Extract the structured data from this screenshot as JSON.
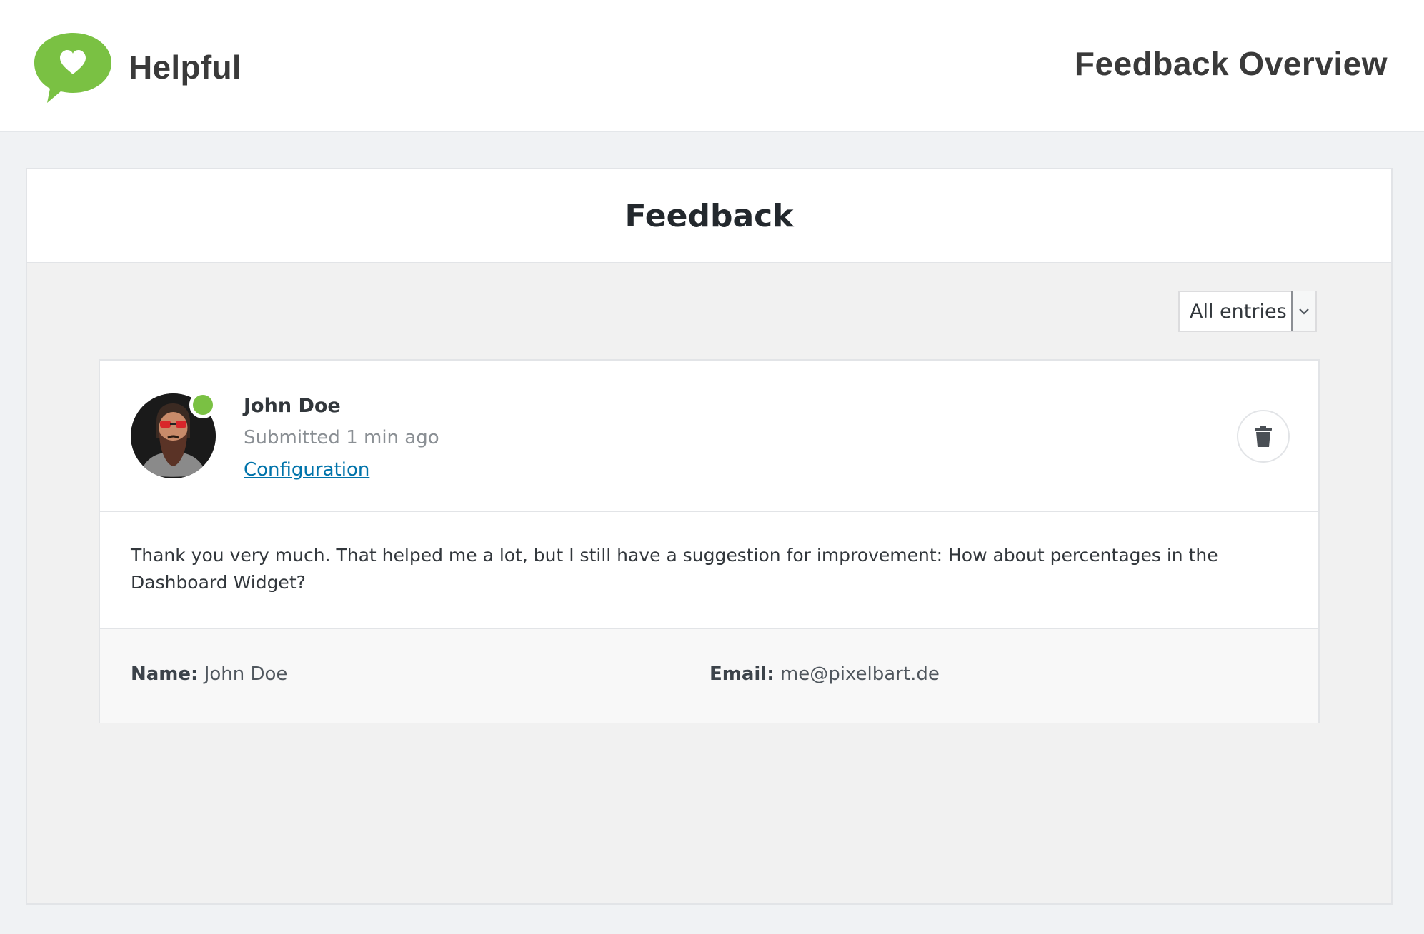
{
  "header": {
    "brand_name": "Helpful",
    "page_heading": "Feedback Overview"
  },
  "panel": {
    "title": "Feedback"
  },
  "filter": {
    "selected": "All entries"
  },
  "feedback": {
    "author": "John Doe",
    "submitted": "Submitted 1 min ago",
    "link_label": "Configuration",
    "status": "online",
    "message": "Thank you very much. That helped me a lot, but I still have a suggestion for improvement: How about percentages in the Dashboard Widget?",
    "meta": {
      "name_label": "Name:",
      "name_value": "John Doe",
      "email_label": "Email:",
      "email_value": "me@pixelbart.de"
    }
  },
  "colors": {
    "brand_green": "#7ac143",
    "link_blue": "#0073aa",
    "status_online": "#7ac143"
  },
  "icons": {
    "logo": "speech-bubble-heart-icon",
    "filter_arrow": "chevron-down-icon",
    "delete": "trash-icon",
    "avatar": "bearded-man-avatar"
  }
}
